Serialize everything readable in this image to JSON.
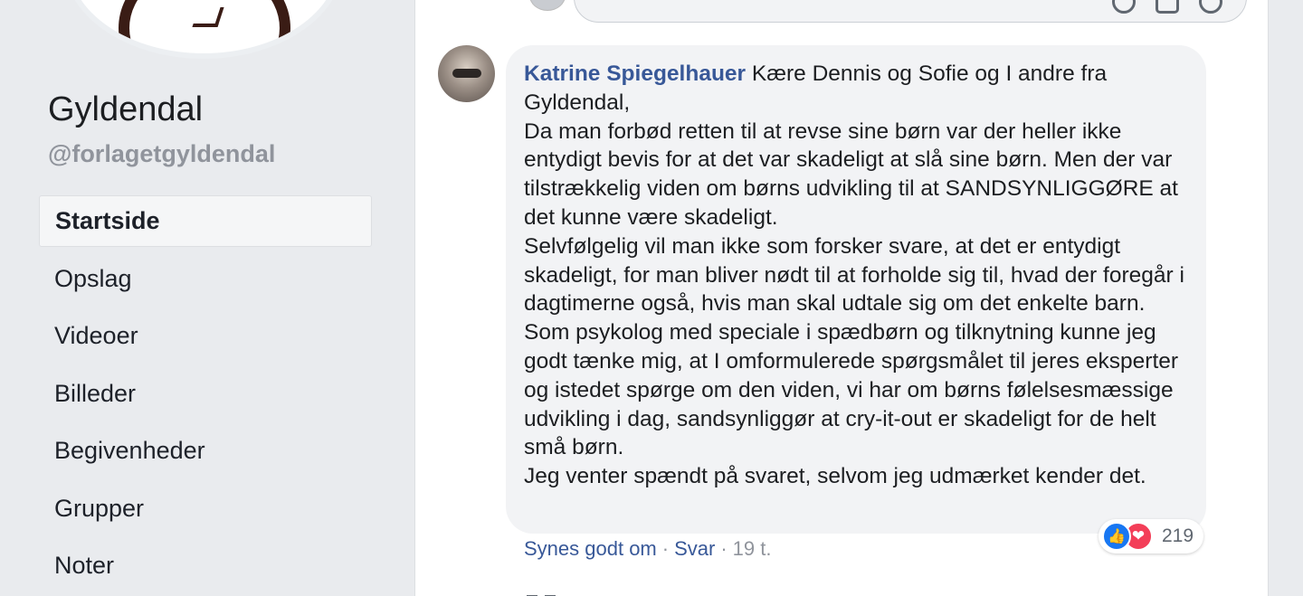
{
  "sidebar": {
    "page_name": "Gyldendal",
    "handle": "@forlagetgyldendal",
    "nav": [
      {
        "label": "Startside",
        "active": true
      },
      {
        "label": "Opslag",
        "active": false
      },
      {
        "label": "Videoer",
        "active": false
      },
      {
        "label": "Billeder",
        "active": false
      },
      {
        "label": "Begivenheder",
        "active": false
      },
      {
        "label": "Grupper",
        "active": false
      },
      {
        "label": "Noter",
        "active": false
      }
    ]
  },
  "composer": {
    "icons": [
      "emoji-icon",
      "camera-icon",
      "sticker-icon"
    ]
  },
  "comment": {
    "author": "Katrine Spiegelhauer",
    "lines": [
      " Kære Dennis og Sofie og I andre fra Gyldendal,",
      "Da man forbød retten til at revse sine børn var der heller ikke entydigt bevis for at det var skadeligt at slå sine børn. Men der var tilstrækkelig viden om børns udvikling til at SANDSYNLIGGØRE at det kunne være skadeligt.",
      "Selvfølgelig vil man ikke som forsker svare, at det er entydigt skadeligt, for man bliver nødt til at forholde sig til, hvad der foregår i dagtimerne også, hvis man skal udtale sig om det enkelte barn.",
      "Som psykolog med speciale i spædbørn og tilknytning kunne jeg godt tænke mig, at I omformulerede spørgsmålet til jeres eksperter og istedet spørge om den viden, vi har om børns følelsesmæssige udvikling i dag, sandsynliggør at cry-it-out er skadeligt for de helt små børn.",
      "Jeg venter spændt på svaret, selvom jeg udmærket kender det."
    ],
    "reaction_count": "219",
    "like_label": "Synes godt om",
    "reply_label": "Svar",
    "separator": "·",
    "time": "19 t."
  },
  "colors": {
    "link": "#385898",
    "bubble": "#f2f3f5",
    "like": "#1877f2",
    "love": "#f33e58"
  }
}
